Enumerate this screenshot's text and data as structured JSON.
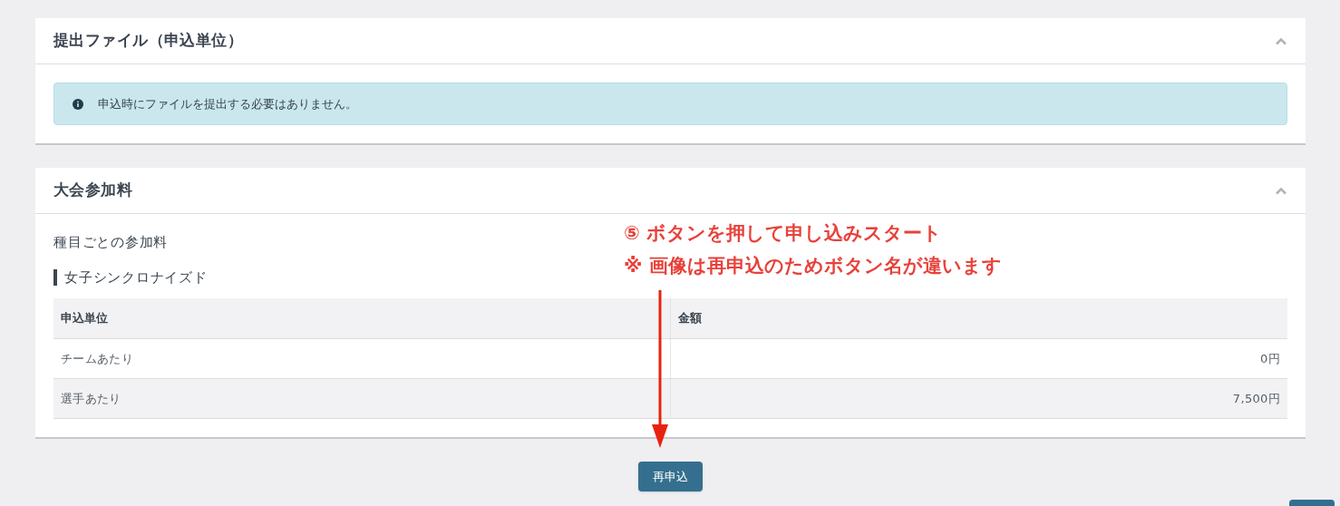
{
  "sections": [
    {
      "kind": "notice",
      "title": "提出ファイル（申込単位）",
      "expanded": true,
      "notice": "申込時にファイルを提出する必要はありません。"
    },
    {
      "kind": "fees",
      "title": "大会参加料",
      "expanded": true,
      "subtitle": "種目ごとの参加料",
      "event": "女子シンクロナイズド",
      "table": {
        "columns": [
          "申込単位",
          "金額"
        ],
        "rows": [
          [
            "チームあたり",
            "0円"
          ],
          [
            "選手あたり",
            "7,500円"
          ]
        ]
      }
    }
  ],
  "annotation": {
    "lines": [
      "⑤ ボタンを押して申し込みスタート",
      "※ 画像は再申込のためボタン名が違います"
    ]
  },
  "submit_button": "再申込"
}
